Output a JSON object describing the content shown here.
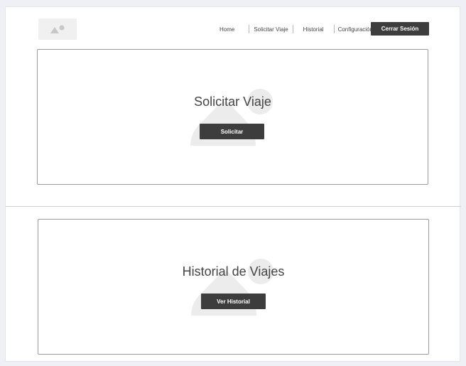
{
  "header": {
    "logo_icon": "image-placeholder-icon",
    "nav": [
      "Home",
      "Solicitar Viaje",
      "Historial",
      "Configuración"
    ],
    "logout_label": "Cerrar Sesión"
  },
  "cards": [
    {
      "title": "Solicitar Viaje",
      "button_label": "Solicitar",
      "background_icon": "image-placeholder-icon"
    },
    {
      "title": "Historial de Viajes",
      "button_label": "Ver Historial",
      "background_icon": "image-placeholder-icon"
    }
  ],
  "colors": {
    "button_bg": "#3d3d3d",
    "placeholder": "#ececec",
    "page_bg": "#eef0f5"
  }
}
